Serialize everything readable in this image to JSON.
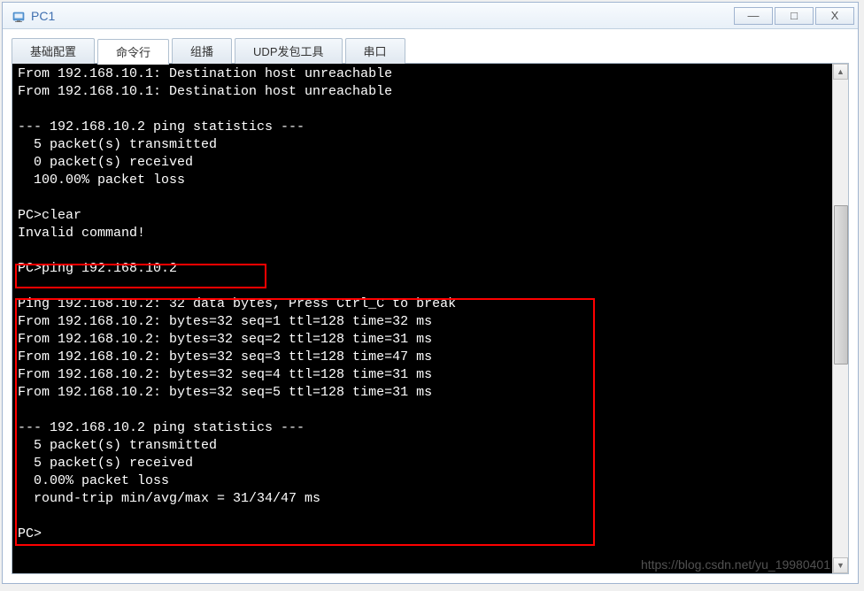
{
  "window": {
    "title": "PC1"
  },
  "tabs": {
    "basic_config": "基础配置",
    "command_line": "命令行",
    "multicast": "组播",
    "udp_tool": "UDP发包工具",
    "serial": "串口"
  },
  "terminal": {
    "lines": [
      "From 192.168.10.1: Destination host unreachable",
      "From 192.168.10.1: Destination host unreachable",
      "",
      "--- 192.168.10.2 ping statistics ---",
      "  5 packet(s) transmitted",
      "  0 packet(s) received",
      "  100.00% packet loss",
      "",
      "PC>clear",
      "Invalid command!",
      "",
      "PC>ping 192.168.10.2",
      "",
      "Ping 192.168.10.2: 32 data bytes, Press Ctrl_C to break",
      "From 192.168.10.2: bytes=32 seq=1 ttl=128 time=32 ms",
      "From 192.168.10.2: bytes=32 seq=2 ttl=128 time=31 ms",
      "From 192.168.10.2: bytes=32 seq=3 ttl=128 time=47 ms",
      "From 192.168.10.2: bytes=32 seq=4 ttl=128 time=31 ms",
      "From 192.168.10.2: bytes=32 seq=5 ttl=128 time=31 ms",
      "",
      "--- 192.168.10.2 ping statistics ---",
      "  5 packet(s) transmitted",
      "  5 packet(s) received",
      "  0.00% packet loss",
      "  round-trip min/avg/max = 31/34/47 ms",
      "",
      "PC>"
    ]
  },
  "watermark": "https://blog.csdn.net/yu_19980401",
  "scrollbar": {
    "up_glyph": "▲",
    "down_glyph": "▼"
  },
  "titlebar_buttons": {
    "minimize": "—",
    "maximize": "□",
    "close": "X"
  }
}
